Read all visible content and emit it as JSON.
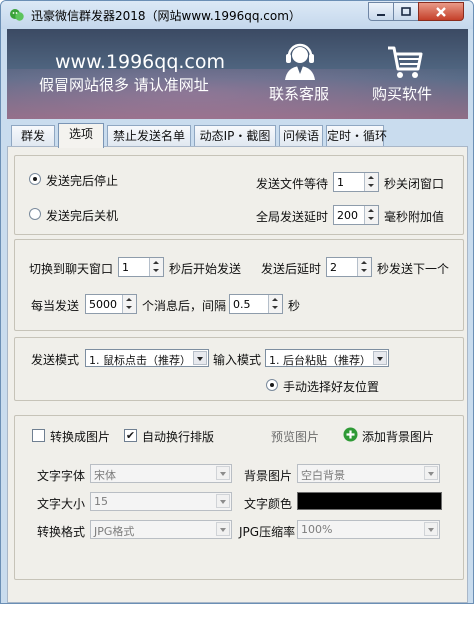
{
  "window": {
    "title": "迅豪微信群发器2018（网站www.1996qq.com）",
    "controls": {
      "minimize": "−",
      "maximize": "□",
      "close": "✕"
    }
  },
  "banner": {
    "url": "www.1996qq.com",
    "warning": "假冒网站很多 请认准网址",
    "customer_service": "联系客服",
    "buy_software": "购买软件",
    "icons": {
      "customer_service": "headset-agent-icon",
      "buy_software": "shopping-cart-icon"
    }
  },
  "tabs": [
    "群发",
    "选项",
    "禁止发送名单",
    "动态IP・截图",
    "问候语",
    "定时・循环"
  ],
  "active_tab": "选项",
  "section1": {
    "stop_after_send": "发送完后停止",
    "shutdown_after_send": "发送完后关机",
    "file_wait_label": "发送文件等待",
    "file_wait_value": "1",
    "close_window_suffix": "秒关闭窗口",
    "global_delay_label": "全局发送延时",
    "global_delay_value": "200",
    "global_delay_suffix": "毫秒附加值"
  },
  "section2": {
    "switch_chat_label": "切换到聊天窗口",
    "switch_chat_value": "1",
    "switch_chat_suffix": "秒后开始发送",
    "after_send_label": "发送后延时",
    "after_send_value": "2",
    "after_send_suffix": "秒发送下一个",
    "every_send_label": "每当发送",
    "every_send_value": "5000",
    "every_send_suffix": "个消息后，间隔",
    "interval_value": "0.5",
    "interval_suffix": "秒"
  },
  "section3": {
    "send_mode_label": "发送模式",
    "send_mode_value": "1. 鼠标点击（推荐）",
    "input_mode_label": "输入模式",
    "input_mode_value": "1. 后台粘贴（推荐）",
    "manual_select_label": "手动选择好友位置"
  },
  "section4": {
    "convert_image_label": "转换成图片",
    "auto_wrap_label": "自动换行排版",
    "preview_image": "预览图片",
    "add_background": "添加背景图片",
    "font_label": "文字字体",
    "font_value": "宋体",
    "bg_image_label": "背景图片",
    "bg_image_value": "空白背景",
    "font_size_label": "文字大小",
    "font_size_value": "15",
    "text_color_label": "文字颜色",
    "text_color_value": "#000000",
    "format_label": "转换格式",
    "format_value": "JPG格式",
    "jpg_quality_label": "JPG压缩率",
    "jpg_quality_value": "100%"
  }
}
